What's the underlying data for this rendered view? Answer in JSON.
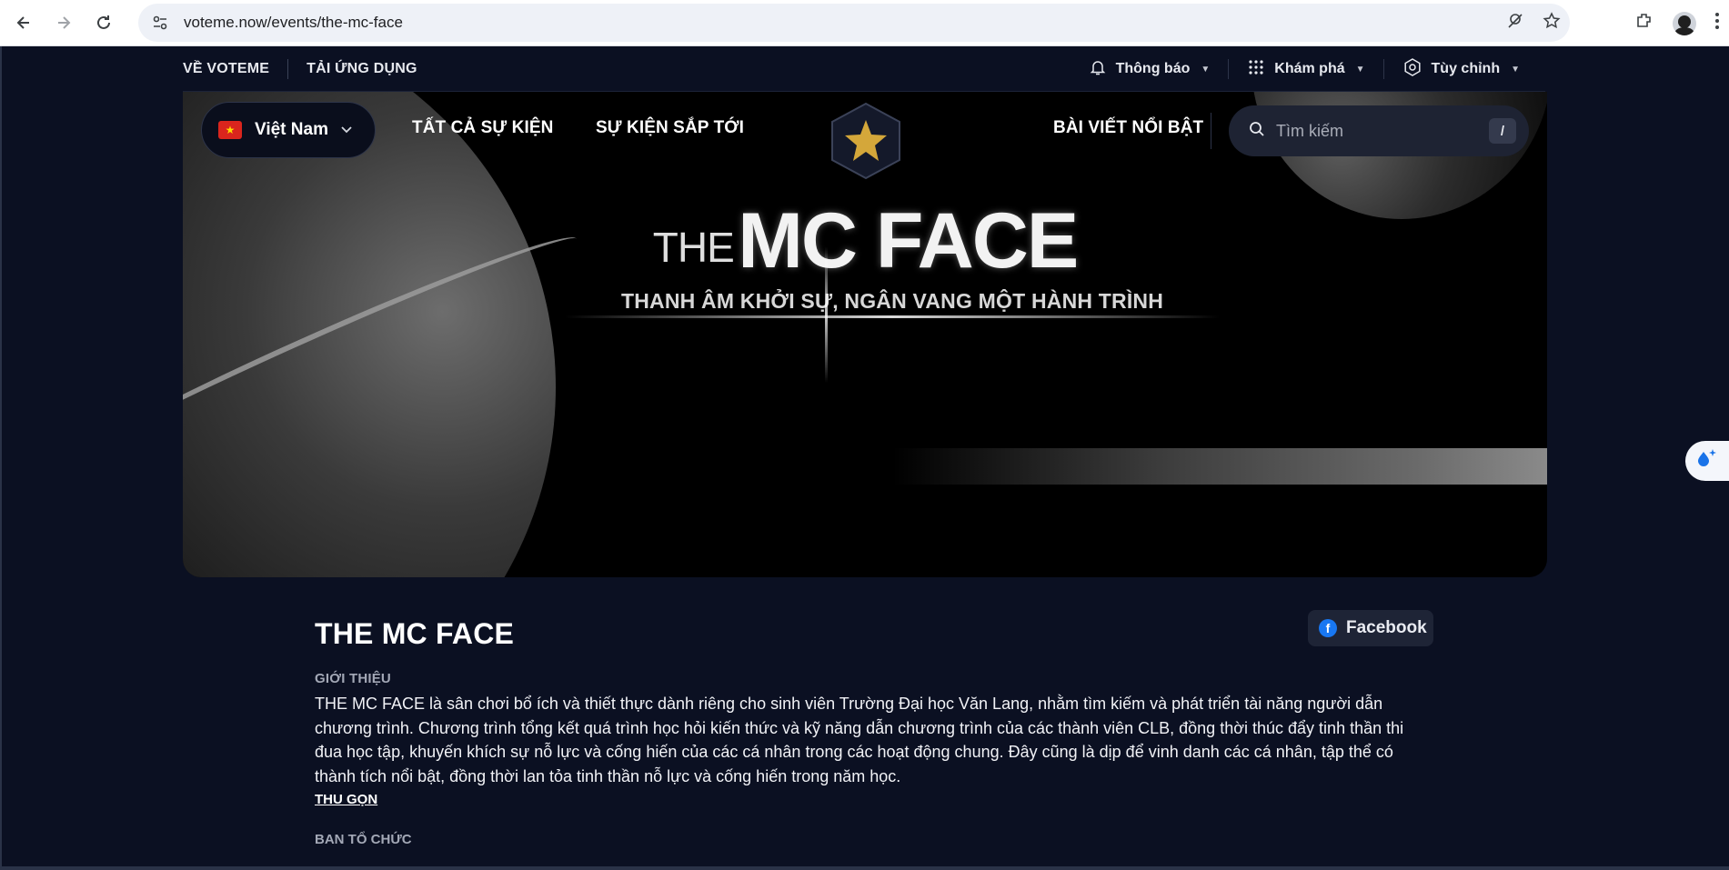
{
  "browser": {
    "url": "voteme.now/events/the-mc-face",
    "back_icon": "←",
    "forward_icon": "→",
    "reload_icon": "↻",
    "star_icon": "☆"
  },
  "util_bar": {
    "about": "VỀ VOTEME",
    "download": "TẢI ỨNG DỤNG",
    "notifications": "Thông báo",
    "explore": "Khám phá",
    "customize": "Tùy chỉnh"
  },
  "nav": {
    "country": "Việt Nam",
    "all_events": "TẤT CẢ SỰ KIỆN",
    "upcoming_events": "SỰ KIỆN SẮP TỚI",
    "featured_posts": "BÀI VIẾT NỔI BẬT",
    "search_placeholder": "Tìm kiếm",
    "search_shortcut": "/"
  },
  "hero": {
    "the": "THE",
    "title": "MC FACE",
    "subtitle": "THANH ÂM KHỞI SỰ, NGÂN VANG MỘT HÀNH TRÌNH"
  },
  "event": {
    "title": "THE MC FACE",
    "facebook_label": "Facebook",
    "intro_label": "GIỚI THIỆU",
    "intro_text": "THE MC FACE là sân chơi bổ ích và thiết thực dành riêng cho sinh viên Trường Đại học Văn Lang, nhằm tìm kiếm và phát triển tài năng người dẫn chương trình. Chương trình tổng kết quá trình học hỏi kiến thức và kỹ năng dẫn chương trình của các thành viên CLB, đồng thời thúc đẩy tinh thần thi đua học tập, khuyến khích sự nỗ lực và cống hiến của các cá nhân trong các hoạt động chung. Đây cũng là dịp để vinh danh các cá nhân, tập thể có thành tích nổi bật, đồng thời lan tỏa tinh thần nỗ lực và cống hiến trong năm học.",
    "collapse": "THU GỌN",
    "organizer_label": "BAN TỔ CHỨC"
  },
  "colors": {
    "page_bg": "#0b1022",
    "facebook_blue": "#1877f2",
    "flag_red": "#da251d",
    "flag_star": "#ffdd00",
    "logo_gold": "#d4a73a"
  }
}
